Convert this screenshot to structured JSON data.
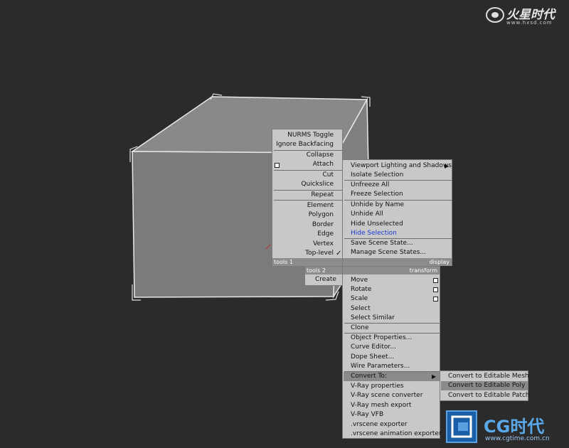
{
  "watermark_top": {
    "title": "火星时代",
    "url": "www.hxsd.com"
  },
  "watermark_bottom": {
    "title": "CG时代",
    "url": "www.cgtime.com.cn"
  },
  "quad_left": {
    "top_items": [
      "NURMS Toggle",
      "Ignore Backfacing",
      "Collapse",
      "Attach",
      "Cut",
      "Quickslice",
      "Repeat"
    ],
    "sub_items": [
      "Element",
      "Polygon",
      "Border",
      "Edge",
      "Vertex",
      "Top-level"
    ],
    "footer": "tools 1",
    "checkmark": "✓"
  },
  "quad_right": {
    "items": [
      "Viewport Lighting and Shadows",
      "Isolate Selection",
      "Unfreeze All",
      "Freeze Selection",
      "Unhide by Name",
      "Unhide All",
      "Hide Unselected",
      "Hide Selection",
      "Save Scene State...",
      "Manage Scene States..."
    ],
    "footer": "display",
    "arrow": "▶"
  },
  "tools2": {
    "header": "tools 2",
    "item": "Create"
  },
  "transform": {
    "header": "transform",
    "items": [
      "Move",
      "Rotate",
      "Scale",
      "Select",
      "Select Similar",
      "Clone",
      "Object Properties...",
      "Curve Editor...",
      "Dope Sheet...",
      "Wire Parameters...",
      "Convert To:",
      "V-Ray properties",
      "V-Ray scene converter",
      "V-Ray mesh export",
      "V-Ray VFB",
      ".vrscene exporter",
      ".vrscene animation exporter"
    ],
    "arrow": "▶"
  },
  "convert_submenu": {
    "items": [
      "Convert to Editable Mesh",
      "Convert to Editable Poly",
      "Convert to Editable Patch"
    ]
  }
}
